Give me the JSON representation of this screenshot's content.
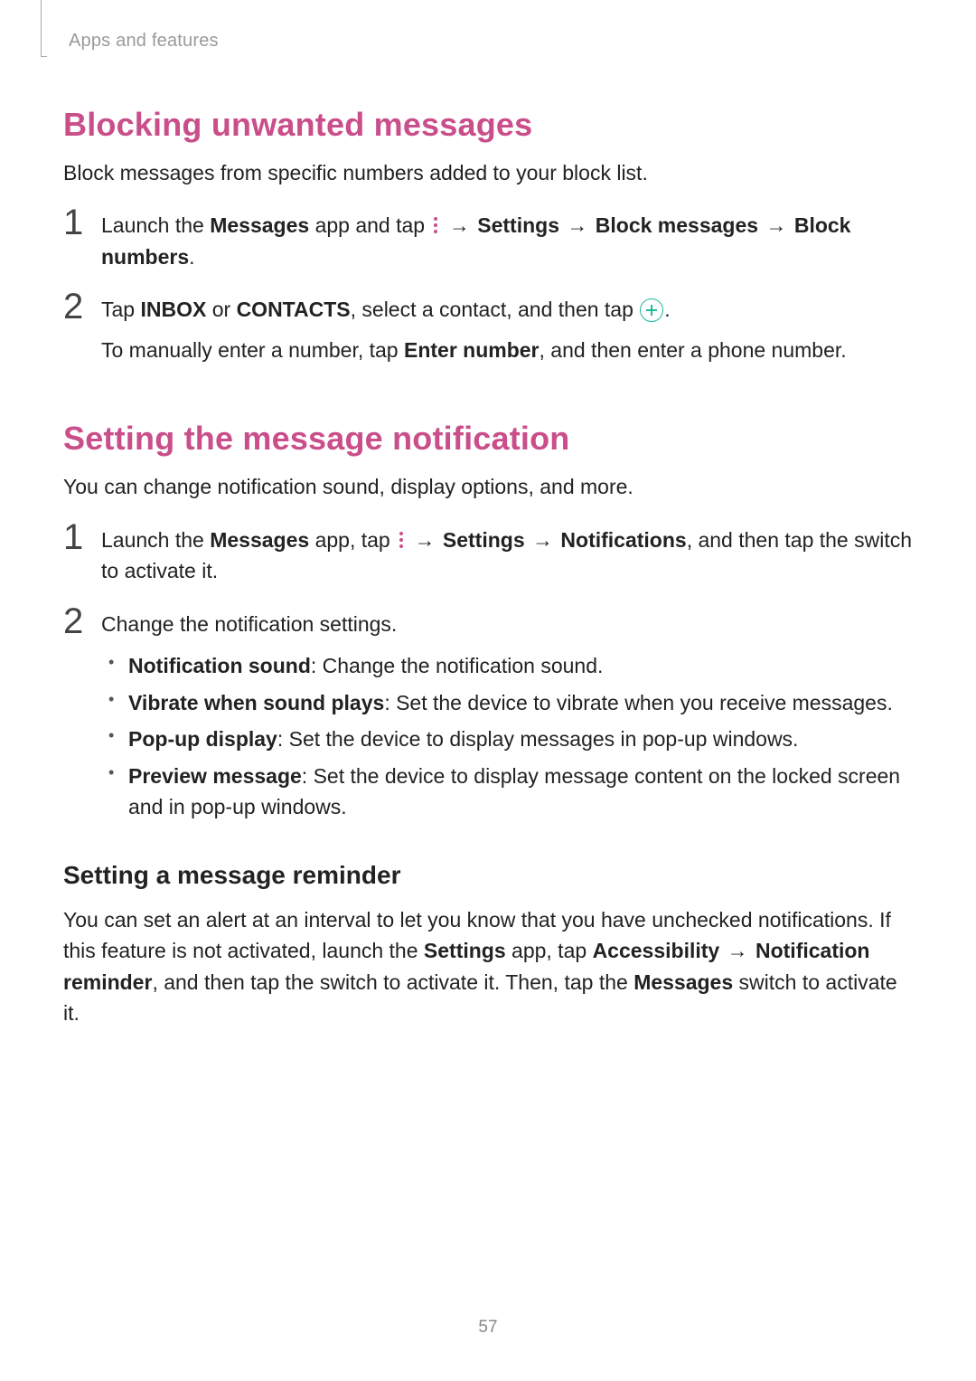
{
  "header": {
    "breadcrumb": "Apps and features"
  },
  "section1": {
    "title": "Blocking unwanted messages",
    "intro": "Block messages from specific numbers added to your block list.",
    "step1": {
      "num": "1",
      "t1": "Launch the ",
      "t2": "Messages",
      "t3": " app and tap ",
      "arrow": "→",
      "settings": "Settings",
      "block_messages": "Block messages",
      "block_numbers": "Block numbers",
      "period": "."
    },
    "step2": {
      "num": "2",
      "t1": "Tap ",
      "inbox": "INBOX",
      "or": " or ",
      "contacts": "CONTACTS",
      "t2": ", select a contact, and then tap ",
      "period": ".",
      "sub1": "To manually enter a number, tap ",
      "enter_number": "Enter number",
      "sub2": ", and then enter a phone number."
    }
  },
  "section2": {
    "title": "Setting the message notification",
    "intro": "You can change notification sound, display options, and more.",
    "step1": {
      "num": "1",
      "t1": "Launch the ",
      "t2": "Messages",
      "t3": " app, tap ",
      "arrow": "→",
      "settings": "Settings",
      "notifications": "Notifications",
      "t4": ", and then tap the switch to activate it."
    },
    "step2": {
      "num": "2",
      "t1": "Change the notification settings.",
      "bullets": [
        {
          "label": "Notification sound",
          "desc": ": Change the notification sound."
        },
        {
          "label": "Vibrate when sound plays",
          "desc": ": Set the device to vibrate when you receive messages."
        },
        {
          "label": "Pop-up display",
          "desc": ": Set the device to display messages in pop-up windows."
        },
        {
          "label": "Preview message",
          "desc": ": Set the device to display message content on the locked screen and in pop-up windows."
        }
      ]
    }
  },
  "section3": {
    "title": "Setting a message reminder",
    "p1a": "You can set an alert at an interval to let you know that you have unchecked notifications. If this feature is not activated, launch the ",
    "settings": "Settings",
    "p1b": " app, tap ",
    "accessibility": "Accessibility",
    "arrow": "→",
    "notification_reminder": "Notification reminder",
    "p1c": ", and then tap the switch to activate it. Then, tap the ",
    "messages": "Messages",
    "p1d": " switch to activate it."
  },
  "page_number": "57",
  "icons": {
    "more": "more-options-icon",
    "plus": "add-icon"
  }
}
